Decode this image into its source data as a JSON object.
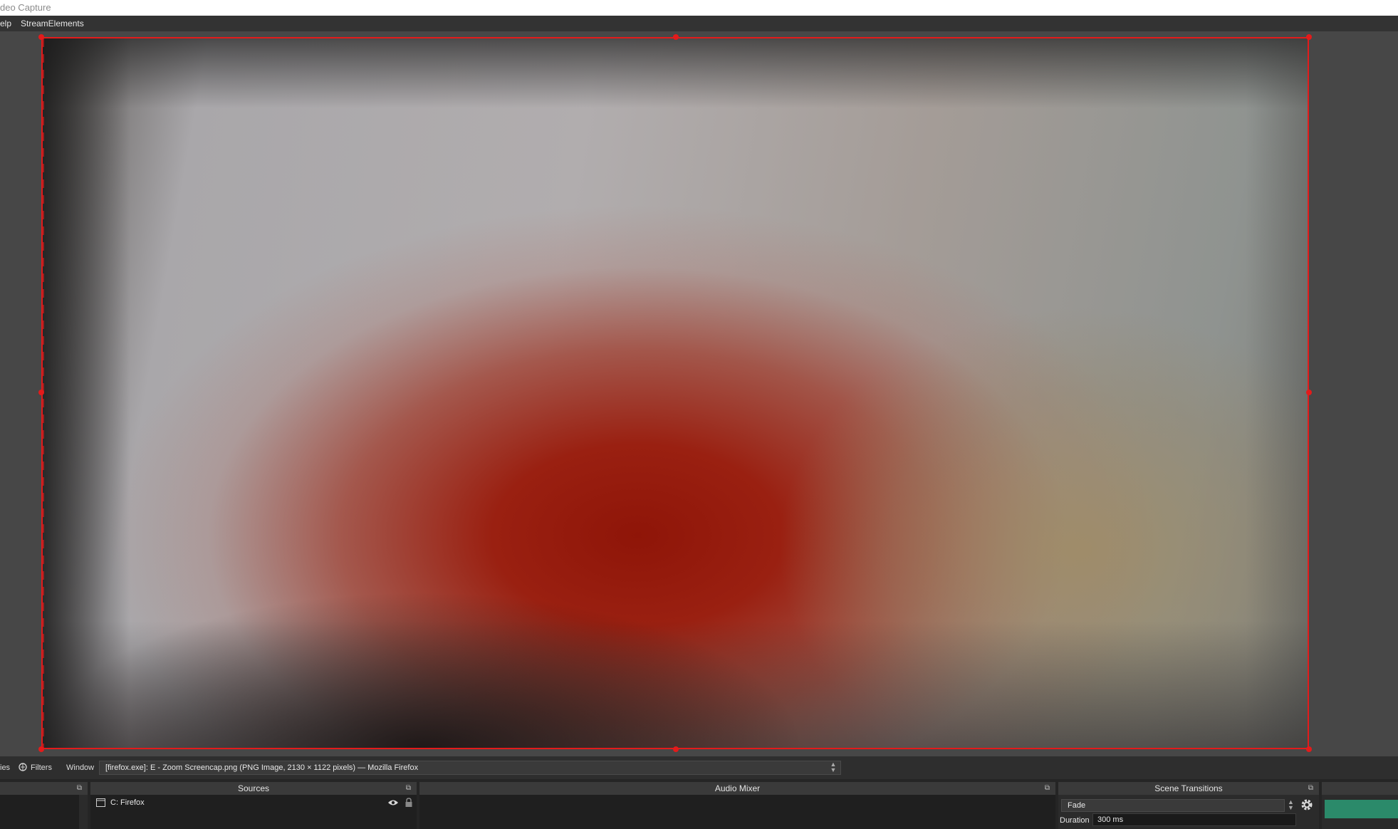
{
  "window": {
    "title": "deo Capture"
  },
  "menubar": {
    "items": [
      "elp",
      "StreamElements"
    ]
  },
  "context_bar": {
    "left_label": "ies",
    "filters_label": "Filters",
    "window_label": "Window",
    "window_value": "[firefox.exe]: E - Zoom Screencap.png (PNG Image, 2130 × 1122 pixels) — Mozilla Firefox"
  },
  "docks": {
    "sources": {
      "title": "Sources",
      "items": [
        {
          "label": "C: Firefox"
        }
      ]
    },
    "audio_mixer": {
      "title": "Audio Mixer"
    },
    "scene_transitions": {
      "title": "Scene Transitions",
      "transition": "Fade",
      "duration_label": "Duration",
      "duration_value": "300 ms"
    }
  },
  "colors": {
    "selection": "#e31b1b",
    "accent_button": "#2b8a6a",
    "panel_bg": "#2b2b2b"
  },
  "icons": [
    "filter-icon",
    "window-icon",
    "eye-icon",
    "lock-icon",
    "gear-icon",
    "popout-icon",
    "spin-arrows-icon"
  ]
}
